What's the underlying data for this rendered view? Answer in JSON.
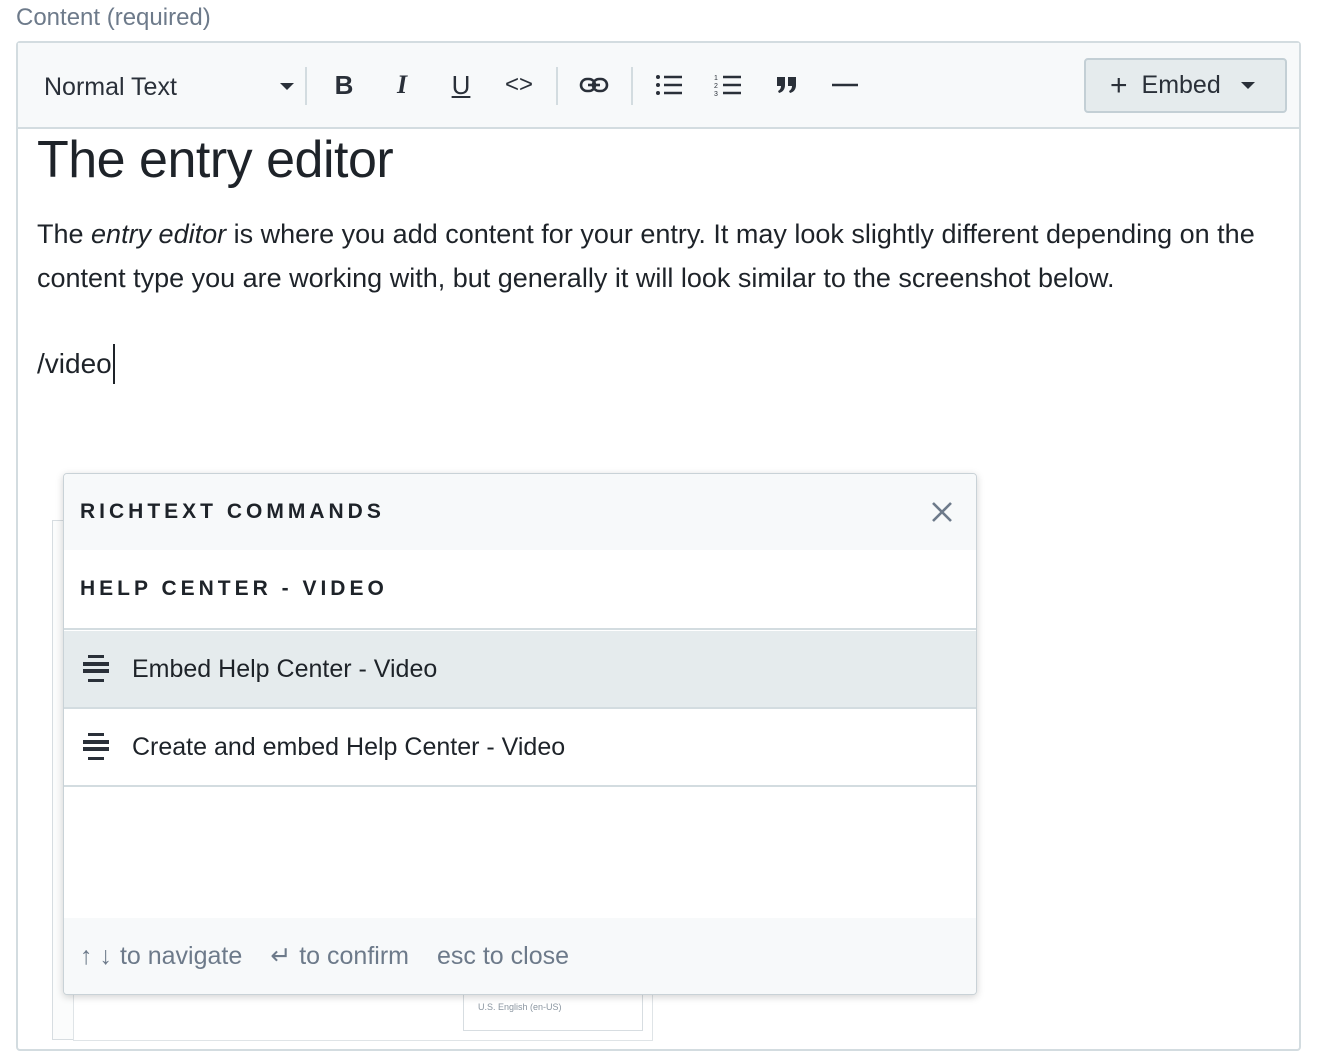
{
  "field": {
    "label": "Content (required)"
  },
  "toolbar": {
    "text_style": "Normal Text",
    "bold_label": "B",
    "italic_label": "I",
    "underline_label": "U",
    "code_label": "<>",
    "embed_label": "Embed",
    "embed_plus": "+"
  },
  "document": {
    "heading": "The entry editor",
    "paragraph_before": "The ",
    "paragraph_emphasis": "entry editor",
    "paragraph_after": " is where you add content for your entry. It may look slightly different depending on the content type you are working with, but generally it will look similar to the screenshot below.",
    "slash_command": "/video"
  },
  "background_card": {
    "mini_field": "U.S. English (en-US)"
  },
  "popup": {
    "title": "RICHTEXT COMMANDS",
    "group_title": "HELP CENTER - VIDEO",
    "items": [
      {
        "label": "Embed Help Center - Video",
        "icon": "embed-block-icon",
        "selected": true
      },
      {
        "label": "Create and embed Help Center - Video",
        "icon": "embed-block-icon",
        "selected": false
      }
    ],
    "footer": {
      "navigate_arrows": "↑ ↓",
      "navigate": "to navigate",
      "confirm_symbol": "↵",
      "confirm": "to confirm",
      "close": "esc to close"
    }
  },
  "colors": {
    "toolbar_bg": "#f7f9fa",
    "border": "#d3dce0",
    "selected_bg": "#e5ebed",
    "text": "#1e2329",
    "muted": "#6d7a8a"
  }
}
